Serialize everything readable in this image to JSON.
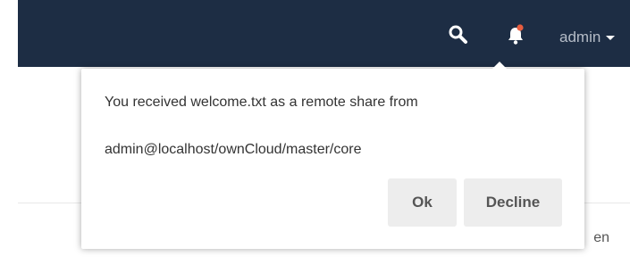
{
  "header": {
    "user_name": "admin",
    "icons": {
      "search": "search-icon",
      "notifications": "bell-icon",
      "dropdown": "caret-down-icon"
    },
    "colors": {
      "bar": "#1d2d44",
      "notification_dot": "#e85d3f"
    }
  },
  "background": {
    "partial_text": "en"
  },
  "dialog": {
    "message_line1": "You received welcome.txt as a remote share from",
    "message_line2": "admin@localhost/ownCloud/master/core",
    "ok_label": "Ok",
    "decline_label": "Decline"
  }
}
